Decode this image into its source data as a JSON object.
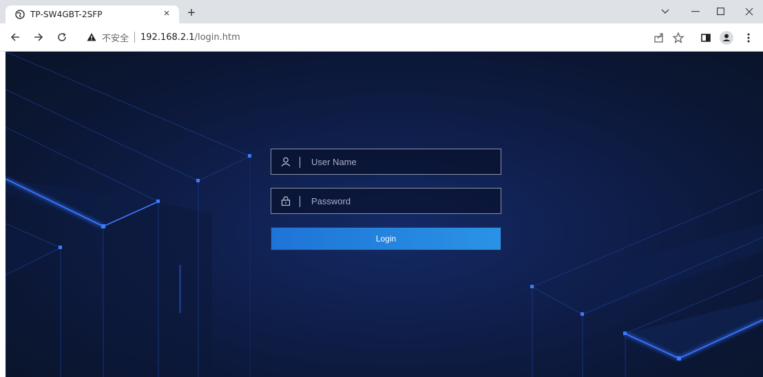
{
  "browser": {
    "tab": {
      "title": "TP-SW4GBT-2SFP",
      "close_glyph": "×"
    },
    "new_tab_glyph": "+",
    "window_controls": {
      "dropdown": "⌵",
      "minimize": "–",
      "maximize": "☐",
      "close": "✕"
    },
    "nav": {
      "back": "←",
      "forward": "→",
      "reload": "C"
    },
    "address": {
      "security_label": "不安全",
      "host": "192.168.2.1",
      "path": "/login.htm"
    },
    "icons": [
      "share-icon",
      "star-icon",
      "side-panel-icon",
      "profile-icon",
      "menu-icon"
    ]
  },
  "login": {
    "username_placeholder": "User Name",
    "password_placeholder": "Password",
    "button_label": "Login"
  },
  "colors": {
    "background": "#0b1633",
    "accent_line": "#2f6bff",
    "button_start": "#1e74d6",
    "button_end": "#2a93e6"
  }
}
